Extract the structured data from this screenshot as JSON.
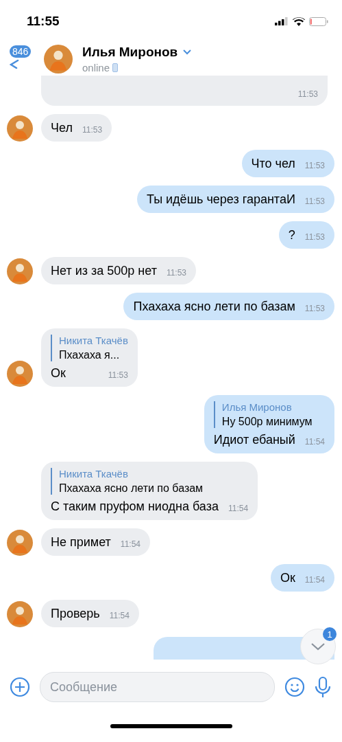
{
  "status_bar": {
    "time": "11:55"
  },
  "header": {
    "unread_count": "846",
    "name": "Илья Миронов",
    "status": "online"
  },
  "messages": [
    {
      "kind": "incoming",
      "cut": true,
      "avatar": false,
      "time": "11:53"
    },
    {
      "kind": "incoming",
      "avatar": true,
      "text": "Чел",
      "time": "11:53"
    },
    {
      "kind": "outgoing",
      "text": "Что чел",
      "time": "11:53"
    },
    {
      "kind": "outgoing",
      "text": "Ты идёшь через гарантаИ",
      "time": "11:53"
    },
    {
      "kind": "outgoing",
      "text": "?",
      "time": "11:53"
    },
    {
      "kind": "incoming",
      "avatar": true,
      "text": "Нет из за 500р нет",
      "time": "11:53"
    },
    {
      "kind": "outgoing",
      "text": "Пхахаха ясно лети по базам",
      "time": "11:53"
    },
    {
      "kind": "incoming",
      "avatar": true,
      "reply": {
        "author": "Никита Ткачёв",
        "text": "Пхахаха я..."
      },
      "text": "Ок",
      "time": "11:53"
    },
    {
      "kind": "outgoing",
      "reply": {
        "author": "Илья Миронов",
        "text": "Ну 500р минимум"
      },
      "text": "Идиот ебаный",
      "time": "11:54"
    },
    {
      "kind": "incoming",
      "avatar": false,
      "reply": {
        "author": "Никита Ткачёв",
        "text": "Пхахаха ясно лети по базам"
      },
      "text": "С таким пруфом ниодна база",
      "time": "11:54"
    },
    {
      "kind": "incoming",
      "avatar": true,
      "text": "Не примет",
      "time": "11:54"
    },
    {
      "kind": "outgoing",
      "text": "Ок",
      "time": "11:54"
    },
    {
      "kind": "incoming",
      "avatar": true,
      "text": "Проверь",
      "time": "11:54"
    },
    {
      "kind": "outgoing",
      "cut": true
    }
  ],
  "scroll_down": {
    "badge": "1"
  },
  "composer": {
    "placeholder": "Сообщение"
  }
}
